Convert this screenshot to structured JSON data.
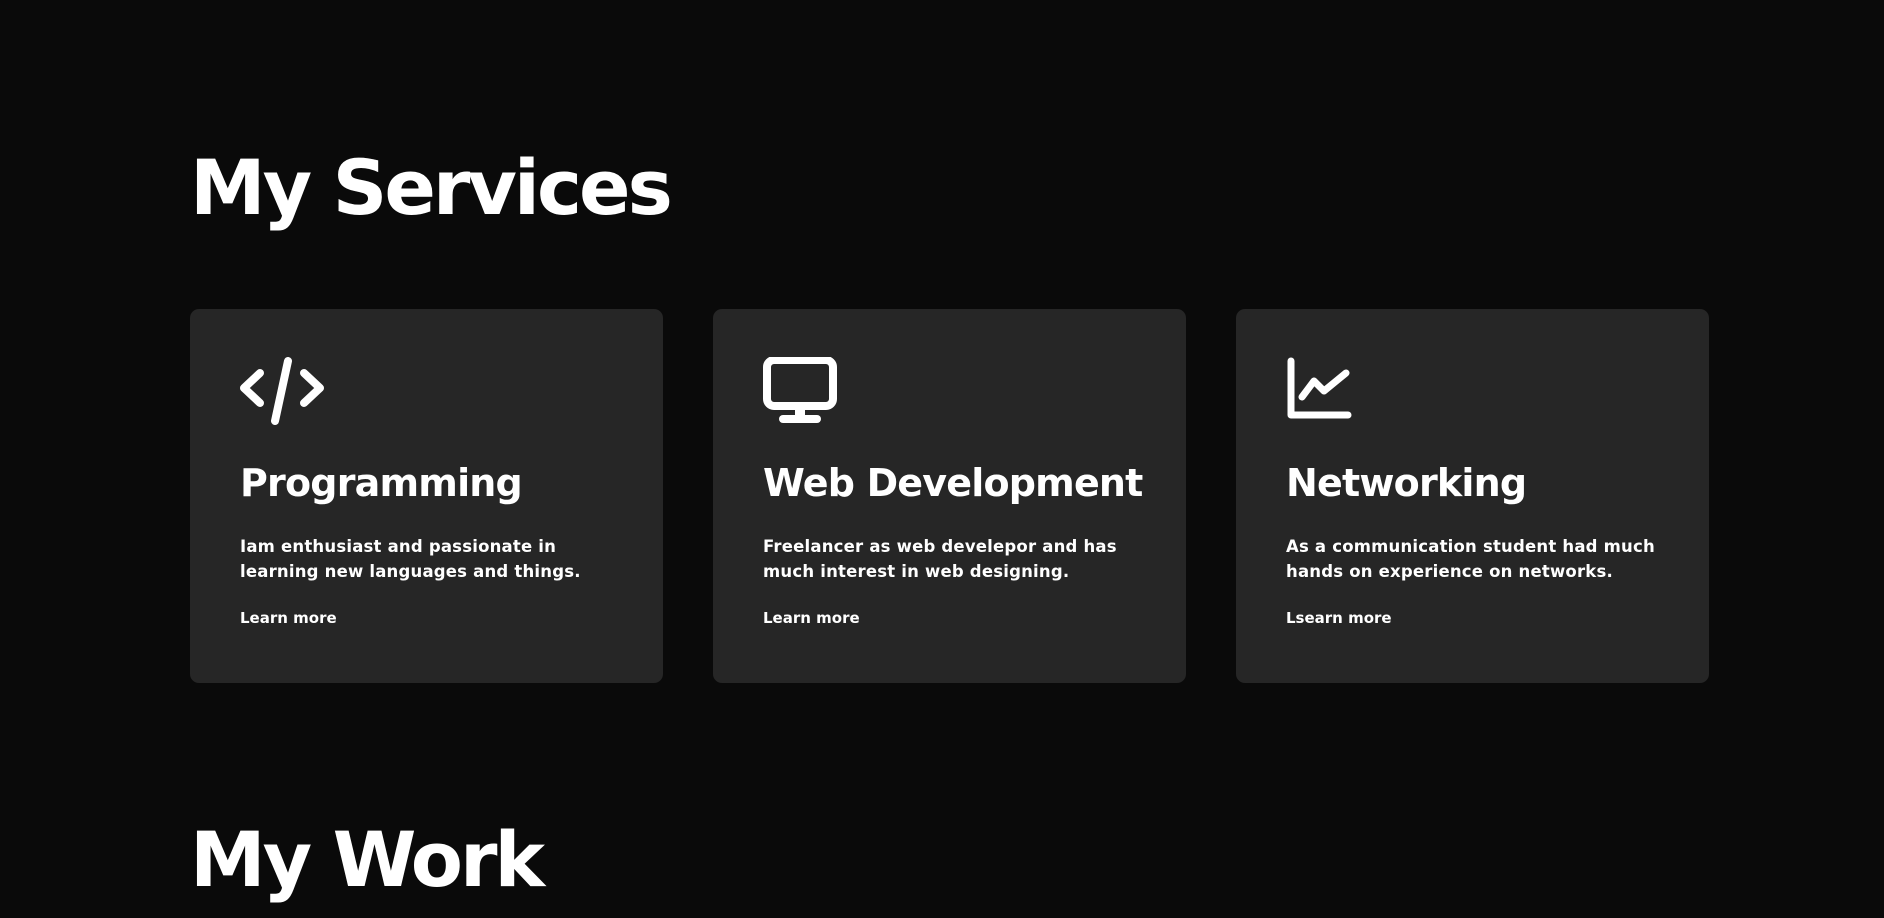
{
  "services": {
    "title": "My Services",
    "cards": [
      {
        "icon": "code-icon",
        "title": "Programming",
        "text": "Iam enthusiast and passionate in learning new languages and things.",
        "link": "Learn more"
      },
      {
        "icon": "desktop-icon",
        "title": "Web Development",
        "text": "Freelancer as web develepor and has much interest in web designing.",
        "link": "Learn more"
      },
      {
        "icon": "line-chart-icon",
        "title": "Networking",
        "text": "As a communication student had much hands on experience on networks.",
        "link": "Lsearn more"
      }
    ]
  },
  "work": {
    "title": "My Work"
  },
  "colors": {
    "background": "#0a0a0a",
    "card": "#262626",
    "text": "#ffffff"
  }
}
